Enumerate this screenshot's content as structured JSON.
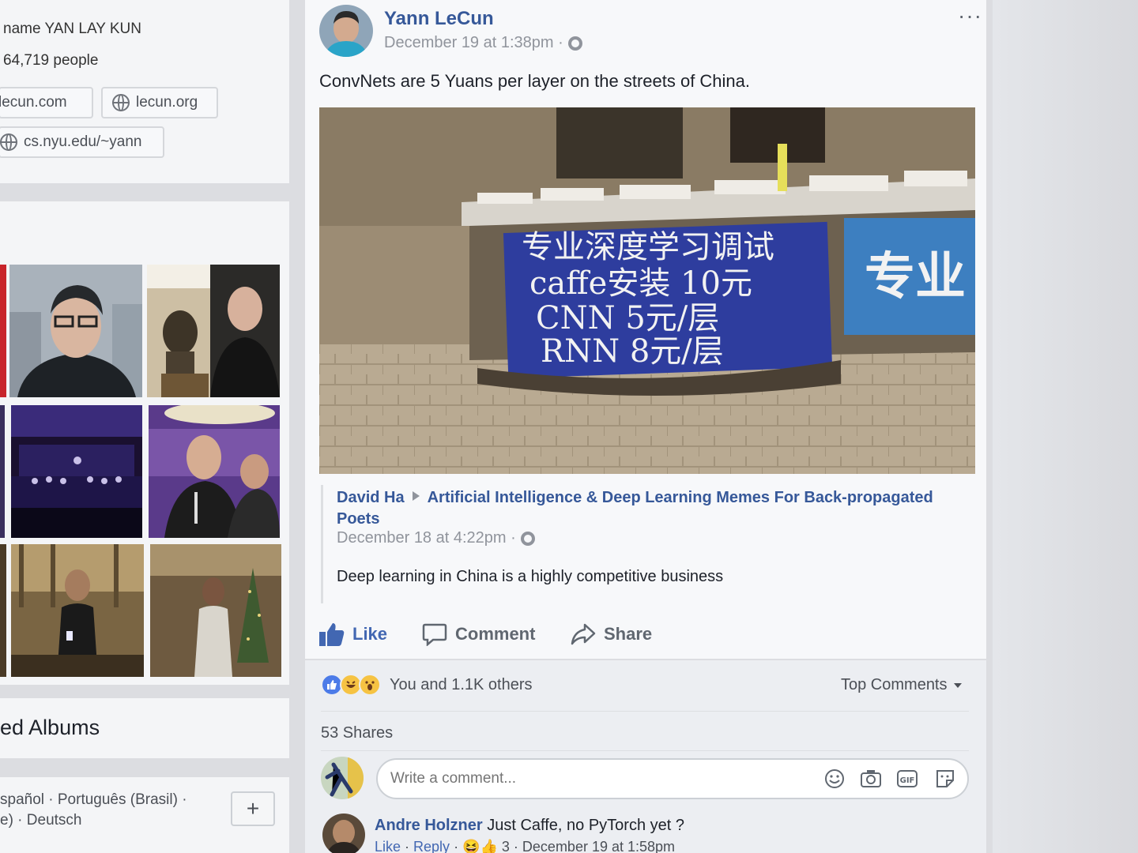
{
  "left": {
    "intro": {
      "name_line": "name YAN LAY KUN",
      "followers_line": "64,719 people",
      "links": [
        "lecun.com",
        "lecun.org",
        "cs.nyu.edu/~yann"
      ]
    },
    "albums_title": "ed Albums",
    "languages": {
      "line1": "spañol · Português (Brasil) ·",
      "line2": "e) · Deutsch"
    },
    "plus_label": "+"
  },
  "post": {
    "author": "Yann LeCun",
    "time": "December 19 at 1:38pm ·",
    "more_label": "···",
    "text": "ConvNets are 5 Yuans per layer on the streets of China.",
    "image": {
      "sign_line1": "专业深度学习调试",
      "sign_line2": "caffe安装 10元",
      "sign_line3": "CNN 5元/层",
      "sign_line4": "RNN 8元/层",
      "sign_right": "专业",
      "sign_color": "#2e3d9e"
    },
    "shared": {
      "from_author": "David Ha",
      "group": "Artificial Intelligence & Deep Learning Memes For Back-propagated Poets",
      "time": "December 18 at 4:22pm ·",
      "text": "Deep learning in China is a highly competitive business"
    },
    "actions": {
      "like": "Like",
      "comment": "Comment",
      "share": "Share"
    },
    "reactions": {
      "summary": "You and 1.1K others",
      "icons": [
        "like-icon",
        "haha-icon",
        "wow-icon"
      ]
    },
    "top_comments": "Top Comments",
    "shares": "53 Shares",
    "comment_placeholder": "Write a comment...",
    "comment_icons": [
      "emoji-icon",
      "camera-icon",
      "gif-icon",
      "sticker-icon"
    ],
    "comment": {
      "author": "Andre Holzner",
      "text": "Just Caffe, no PyTorch yet ?",
      "like": "Like",
      "reply": "Reply",
      "reaction_count": "3",
      "time": "December 19 at 1:58pm"
    }
  },
  "colors": {
    "link_blue": "#365899",
    "action_blue": "#4267b2",
    "secondary": "#90949c"
  }
}
